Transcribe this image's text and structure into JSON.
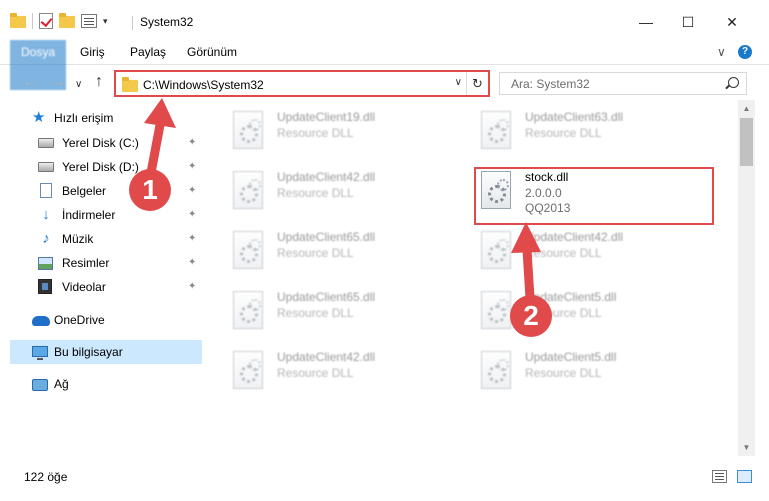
{
  "window": {
    "title": "System32",
    "minimize_glyph": "—",
    "maximize_glyph": "☐",
    "close_glyph": "✕"
  },
  "ribbon": {
    "file_tab": "Dosya",
    "tabs": [
      "Giriş",
      "Paylaş",
      "Görünüm"
    ],
    "collapse_glyph": "∨",
    "help_glyph": "?"
  },
  "address": {
    "path": "C:\\Windows\\System32",
    "dropdown_glyph": "∨",
    "refresh_glyph": "↻"
  },
  "search": {
    "placeholder": "Ara: System32"
  },
  "nav": {
    "back_glyph": "←",
    "forward_glyph": "→",
    "recent_glyph": "∨",
    "up_glyph": "↑"
  },
  "sidebar": {
    "quick_access": "Hızlı erişim",
    "items": [
      {
        "label": "Yerel Disk (C:)",
        "icon": "disk-icon"
      },
      {
        "label": "Yerel Disk (D:)",
        "icon": "disk-icon"
      },
      {
        "label": "Belgeler",
        "icon": "documents-icon"
      },
      {
        "label": "İndirmeler",
        "icon": "downloads-icon"
      },
      {
        "label": "Müzik",
        "icon": "music-icon"
      },
      {
        "label": "Resimler",
        "icon": "pictures-icon"
      },
      {
        "label": "Videolar",
        "icon": "videos-icon"
      }
    ],
    "pin_glyph": "📌",
    "onedrive": "OneDrive",
    "this_pc": "Bu bilgisayar",
    "network": "Ağ"
  },
  "files": [
    {
      "name": "UpdateClient19.dll",
      "desc": "Resource DLL"
    },
    {
      "name": "UpdateClient63.dll",
      "desc": "Resource DLL"
    },
    {
      "name": "UpdateClient42.dll",
      "desc": "Resource DLL"
    },
    {
      "name": "stock.dll",
      "desc": "2.0.0.0",
      "desc2": "QQ2013"
    },
    {
      "name": "UpdateClient65.dll",
      "desc": "Resource DLL"
    },
    {
      "name": "UpdateClient42.dll",
      "desc": "Resource DLL"
    },
    {
      "name": "UpdateClient65.dll",
      "desc": "Resource DLL"
    },
    {
      "name": "UpdateClient5.dll",
      "desc": "Resource DLL"
    },
    {
      "name": "UpdateClient42.dll",
      "desc": "Resource DLL"
    },
    {
      "name": "UpdateClient5.dll",
      "desc": "Resource DLL"
    }
  ],
  "status": {
    "item_count": "122 öğe"
  },
  "annotations": {
    "step1": "1",
    "step2": "2",
    "highlight_color": "#e04a4a"
  },
  "colors": {
    "accent": "#1979ca",
    "selection": "#cce8ff"
  }
}
